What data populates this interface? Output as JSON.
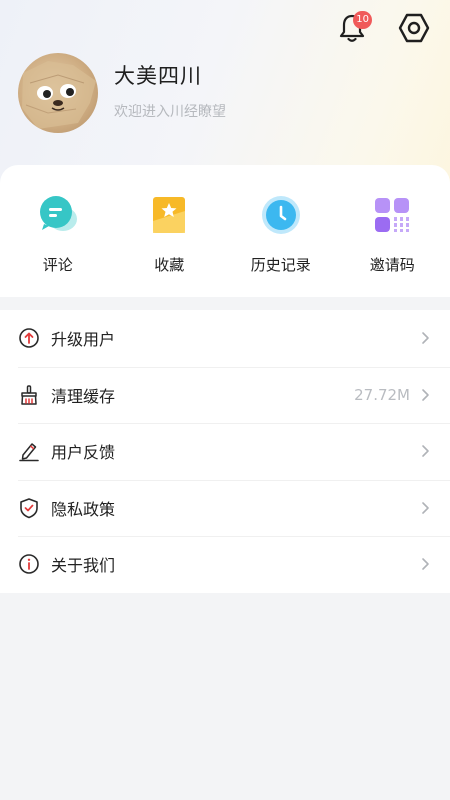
{
  "header": {
    "notification_count": "10",
    "icons": [
      "bell-icon",
      "settings-hexagon-icon"
    ]
  },
  "profile": {
    "username": "大美四川",
    "welcome": "欢迎进入川经瞭望",
    "avatar": "cartoon-character-avatar"
  },
  "quick_actions": [
    {
      "label": "评论",
      "icon": "comment-icon",
      "color": "#36c6c6"
    },
    {
      "label": "收藏",
      "icon": "favorite-star-icon",
      "color": "#f7b928"
    },
    {
      "label": "历史记录",
      "icon": "history-clock-icon",
      "color": "#3cb8f0"
    },
    {
      "label": "邀请码",
      "icon": "invite-code-grid-icon",
      "color": "#9b6cf2"
    }
  ],
  "menu": [
    {
      "label": "升级用户",
      "value": "",
      "icon": "upgrade-arrow-icon"
    },
    {
      "label": "清理缓存",
      "value": "27.72M",
      "icon": "broom-icon"
    },
    {
      "label": "用户反馈",
      "value": "",
      "icon": "edit-pen-icon"
    },
    {
      "label": "隐私政策",
      "value": "",
      "icon": "shield-check-icon"
    },
    {
      "label": "关于我们",
      "value": "",
      "icon": "info-icon"
    }
  ],
  "colors": {
    "accent_red": "#e23a3a",
    "badge": "#f05a5a",
    "text_primary": "#222222",
    "text_secondary": "#b6b9be"
  }
}
